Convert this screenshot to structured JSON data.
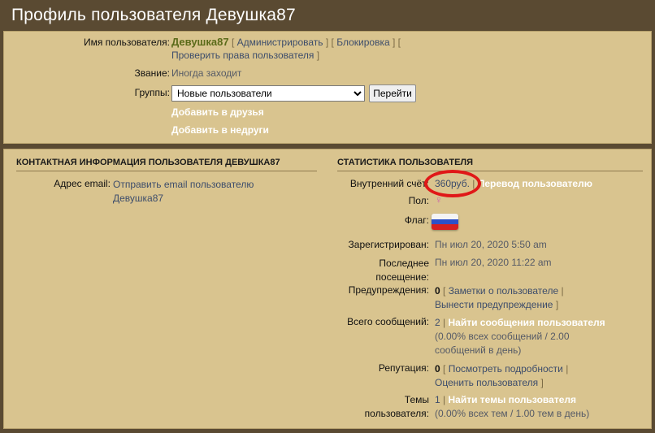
{
  "page": {
    "title": "Профиль пользователя Девушка87"
  },
  "profile": {
    "username_label": "Имя пользователя:",
    "username": "Девушка87",
    "admin_link": "Администрировать",
    "ban_link": "Блокировка",
    "check_rights_link": "Проверить права пользователя",
    "rank_label": "Звание:",
    "rank": "Иногда заходит",
    "groups_label": "Группы:",
    "groups_selected": "Новые пользователи",
    "go_button": "Перейти",
    "add_friend": "Добавить в друзья",
    "add_foe": "Добавить в недруги"
  },
  "contact": {
    "heading": "Контактная информация пользователя Девушка87",
    "email_label": "Адрес email:",
    "email_link_line1": "Отправить email пользователю",
    "email_link_line2": "Девушка87"
  },
  "stats": {
    "heading": "Статистика пользователя",
    "account_label": "Внутренний счёт:",
    "account_value": "360руб.",
    "transfer_link": "Перевод пользователю",
    "gender_label": "Пол:",
    "gender_symbol": "♀",
    "flag_label": "Флаг:",
    "registered_label": "Зарегистрирован:",
    "registered_value": "Пн июл 20, 2020 5:50 am",
    "last_visit_label_line1": "Последнее",
    "last_visit_label_line2": "посещение:",
    "last_visit_value": "Пн июл 20, 2020 11:22 am",
    "warnings_label": "Предупреждения:",
    "warnings_count": "0",
    "notes_link": "Заметки о пользователе",
    "remove_warning_link": "Вынести предупреждение",
    "posts_label": "Всего сообщений:",
    "posts_count": "2",
    "find_posts_link": "Найти сообщения пользователя",
    "posts_stats_line1": "(0.00% всех сообщений / 2.00",
    "posts_stats_line2": "сообщений в день)",
    "reputation_label": "Репутация:",
    "reputation_count": "0",
    "rep_details_link": "Посмотреть подробности",
    "rate_user_link": "Оценить пользователя",
    "topics_label_line1": "Темы",
    "topics_label_line2": "пользователя:",
    "topics_count": "1",
    "find_topics_link": "Найти темы пользователя",
    "topics_stats": "(0.00% всех тем / 1.00 тем в день)"
  },
  "colors": {
    "panel_bg": "#d9c48f",
    "username": "#5b6b1a",
    "link": "#3d4d6b",
    "annotation": "#e01818"
  }
}
